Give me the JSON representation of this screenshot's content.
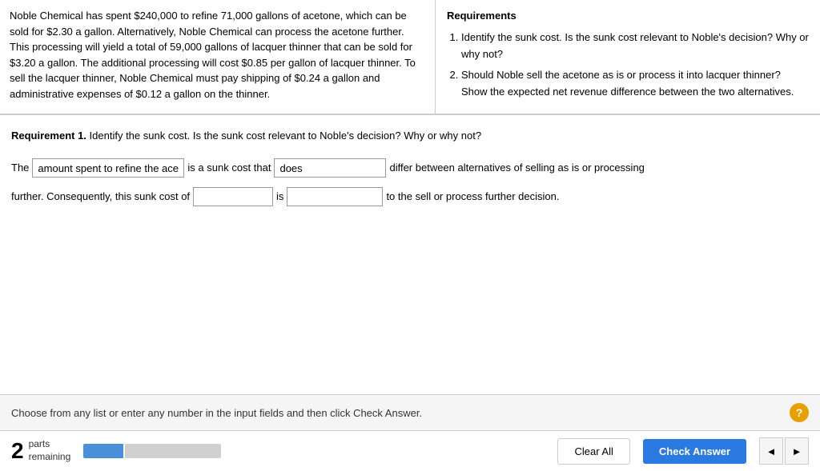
{
  "problem": {
    "text": "Noble Chemical has spent $240,000 to refine 71,000 gallons of acetone, which can be sold for $2.30 a gallon. Alternatively, Noble Chemical can process the acetone further. This processing will yield a total of 59,000 gallons of lacquer thinner that can be sold for $3.20 a gallon. The additional processing will cost $0.85 per gallon of lacquer thinner. To sell the lacquer thinner, Noble Chemical must pay shipping of $0.24 a gallon and administrative expenses of $0.12 a gallon on the thinner."
  },
  "requirements": {
    "title": "Requirements",
    "items": [
      "Identify the sunk cost. Is the sunk cost relevant to Noble's decision? Why or why not?",
      "Should Noble sell the acetone as is or process it into lacquer thinner? Show the expected net revenue difference between the two alternatives."
    ]
  },
  "requirement1": {
    "header": "Requirement 1.",
    "header_text": "Identify the sunk cost. Is the sunk cost relevant to Noble's decision? Why or why not?",
    "sentence_part1": "The",
    "input1_value": "amount spent to refine the acetone",
    "sentence_part2": "is a sunk cost that",
    "input2_value": "does",
    "sentence_part3": "differ between alternatives of selling as is or processing",
    "sentence_part4": "further. Consequently, this sunk cost of",
    "input3_value": "",
    "sentence_part5": "is",
    "input4_value": "",
    "sentence_part6": "to the sell or process further decision."
  },
  "instruction": {
    "text": "Choose from any list or enter any number in the input fields and then click Check Answer."
  },
  "action_bar": {
    "parts_number": "2",
    "parts_label_line1": "parts",
    "parts_label_line2": "remaining",
    "clear_all_label": "Clear All",
    "check_answer_label": "Check Answer",
    "nav_prev": "◄",
    "nav_next": "►",
    "help_symbol": "?"
  }
}
